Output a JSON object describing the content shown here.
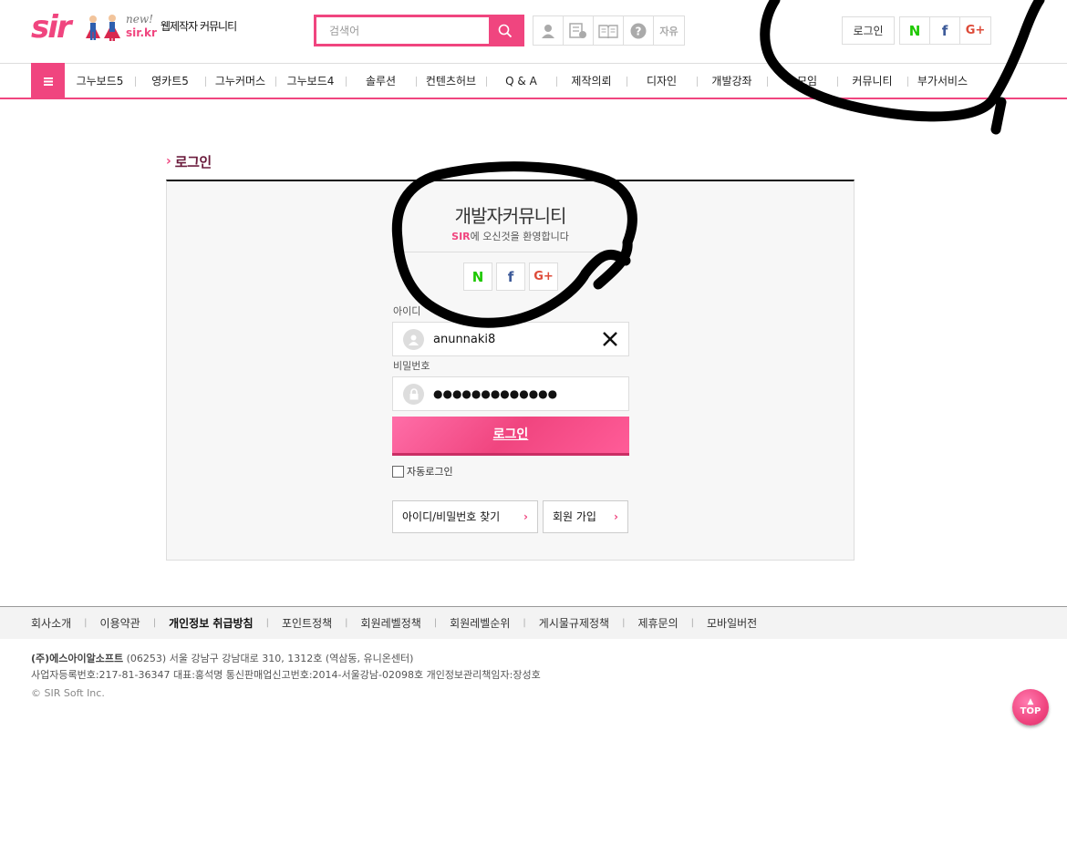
{
  "header": {
    "logo": {
      "brand": "sir",
      "new_label": "new!",
      "url_label": "sir.kr",
      "tagline": "웹제작자 커뮤니티"
    },
    "search": {
      "placeholder": "검색어",
      "value": ""
    },
    "quick_icons": [
      {
        "icon": "person-icon"
      },
      {
        "icon": "memo-icon"
      },
      {
        "icon": "book-icon"
      },
      {
        "icon": "question-icon"
      },
      {
        "label": "자유"
      }
    ],
    "login_label": "로그인",
    "social": [
      {
        "icon": "naver-icon",
        "label": "N",
        "color": "#1ec800"
      },
      {
        "icon": "facebook-icon",
        "label": "f",
        "color": "#3b5998"
      },
      {
        "icon": "google-plus-icon",
        "label": "G+",
        "color": "#dd4b39"
      }
    ]
  },
  "nav": {
    "items": [
      "그누보드5",
      "영카트5",
      "그누커머스",
      "그누보드4",
      "솔루션",
      "컨텐츠허브",
      "Q & A",
      "제작의뢰",
      "디자인",
      "개발강좌",
      "소모임",
      "커뮤니티",
      "부가서비스"
    ]
  },
  "login": {
    "section_title": "로그인",
    "welcome_title": "개발자커뮤니티",
    "welcome_brand": "SIR",
    "welcome_sub": "에 오신것을 환영합니다",
    "id_label": "아이디",
    "id_value": "anunnaki8",
    "pw_label": "비밀번호",
    "pw_value": "●●●●●●●●●●●●●",
    "submit_label": "로그인",
    "auto_login_label": "자동로그인",
    "find_label": "아이디/비밀번호 찾기",
    "join_label": "회원 가입",
    "arrow": "›"
  },
  "footer": {
    "links": [
      {
        "label": "회사소개",
        "bold": false
      },
      {
        "label": "이용약관",
        "bold": false
      },
      {
        "label": "개인정보 취급방침",
        "bold": true
      },
      {
        "label": "포인트정책",
        "bold": false
      },
      {
        "label": "회원레벨정책",
        "bold": false
      },
      {
        "label": "회원레벨순위",
        "bold": false
      },
      {
        "label": "게시물규제정책",
        "bold": false
      },
      {
        "label": "제휴문의",
        "bold": false
      },
      {
        "label": "모바일버전",
        "bold": false
      }
    ],
    "company_name": "(주)에스아이알소프트",
    "address": " (06253) 서울 강남구 강남대로 310, 1312호 (역삼동, 유니온센터)",
    "registration": "사업자등록번호:217-81-36347 대표:홍석명 통신판매업신고번호:2014-서울강남-02098호 개인정보관리책임자:장성호",
    "copyright": "© SIR Soft Inc."
  },
  "top_button": {
    "arrow": "▲",
    "label": "TOP"
  },
  "colors": {
    "accent": "#f0457f",
    "dark_accent": "#6b1b3c",
    "naver": "#1ec800",
    "facebook": "#3b5998",
    "google": "#dd4b39"
  }
}
